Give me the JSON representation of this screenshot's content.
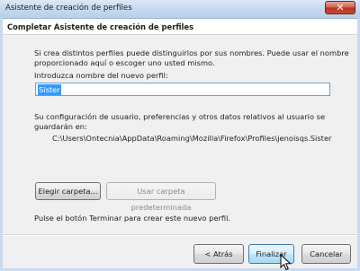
{
  "window": {
    "title": "Asistente de creación de perfiles",
    "close_glyph": "✕"
  },
  "header": {
    "title": "Completar Asistente de creación de perfiles"
  },
  "body": {
    "intro_line1": "Si crea distintos perfiles puede distinguirlos por sus nombres. Puede usar el nombre",
    "intro_line2": "proporcionado aquí o escoger uno usted mismo.",
    "name_label": "Introduzca nombre del nuevo perfil:",
    "name_value": "Sister",
    "config_line1": "Su configuración de usuario, preferencias y otros datos relativos al usuario se",
    "config_line2": "guardarán en:",
    "profile_path": "C:\\Users\\Ontecnia\\AppData\\Roaming\\Mozilla\\Firefox\\Profiles\\jenoisqs.Sister",
    "choose_folder_label": "Elegir carpeta...",
    "default_folder_label": "Usar carpeta predeterminada",
    "finish_hint": "Pulse el botón Terminar para crear este nuevo perfil."
  },
  "footer": {
    "back_label": "< Atrás",
    "finish_label": "Finalizar",
    "cancel_label": "Cancelar"
  }
}
